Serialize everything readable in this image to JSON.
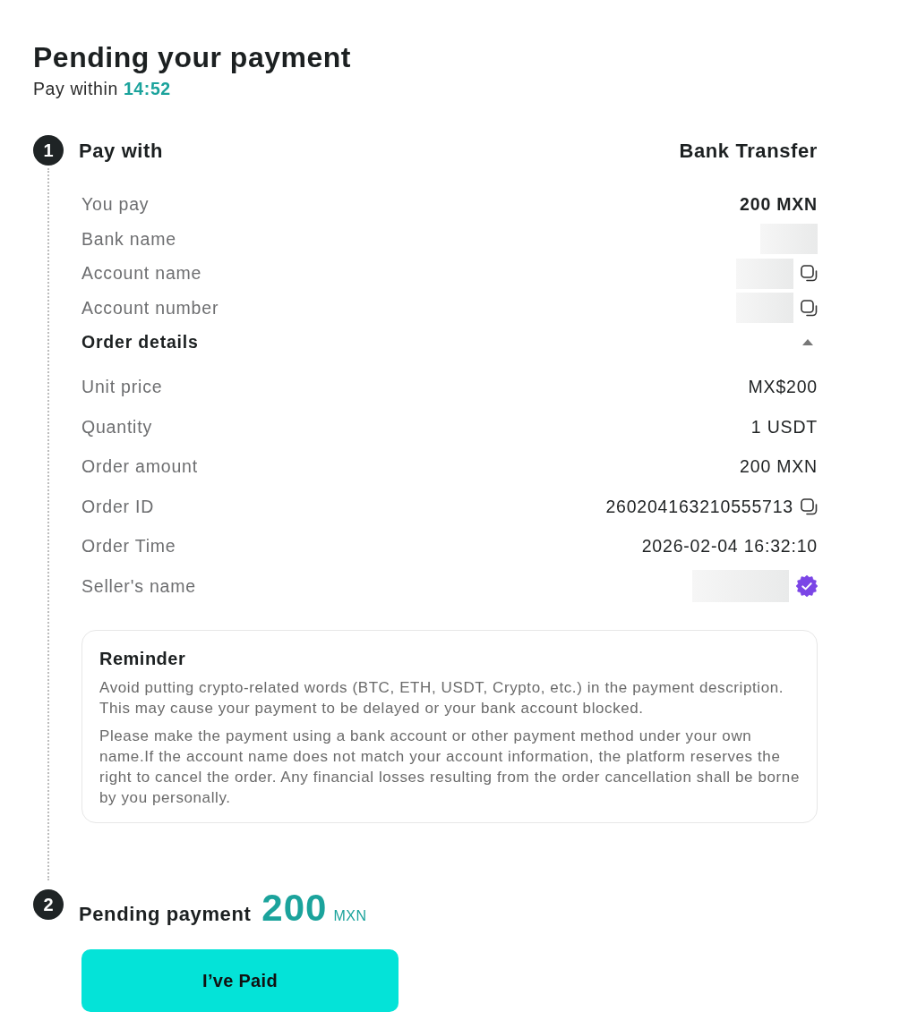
{
  "header": {
    "title": "Pending your payment",
    "countdown_label": "Pay within",
    "countdown": "14:52"
  },
  "pay_with": {
    "number": "1",
    "title": "Pay with",
    "method": "Bank Transfer",
    "you_pay": {
      "label": "You pay",
      "value": "200 MXN"
    },
    "payee_fields": [
      {
        "label": "Bank name",
        "hidden": true,
        "copy": false
      },
      {
        "label": "Account name",
        "hidden": true,
        "copy": true
      },
      {
        "label": "Account number",
        "hidden": true,
        "copy": true
      }
    ],
    "order_details": {
      "title": "Order details",
      "expanded": true,
      "rows": [
        {
          "label": "Unit price",
          "value": "MX$200",
          "copy": false
        },
        {
          "label": "Quantity",
          "value": "1 USDT",
          "copy": false
        },
        {
          "label": "Order amount",
          "value": "200 MXN",
          "copy": false
        },
        {
          "label": "Order ID",
          "value": "260204163210555713",
          "copy": true
        },
        {
          "label": "Order Time",
          "value": "2026-02-04 16:32:10",
          "copy": false
        }
      ],
      "seller": {
        "label": "Seller's name",
        "hidden": true,
        "verified": true
      }
    },
    "reminder": {
      "title": "Reminder",
      "paragraphs": [
        "Avoid putting crypto-related words (BTC, ETH, USDT, Crypto, etc.) in the payment description. This may cause your payment to be delayed or your bank account blocked.",
        "Please make the payment using a bank account or other payment method under your own name.If the account name does not match your account information, the platform reserves the right to cancel the order. Any financial losses resulting from the order cancellation shall be borne by you personally."
      ]
    }
  },
  "pending_payment": {
    "number": "2",
    "title": "Pending payment",
    "amount": "200",
    "currency": "MXN",
    "button": "I’ve Paid"
  }
}
